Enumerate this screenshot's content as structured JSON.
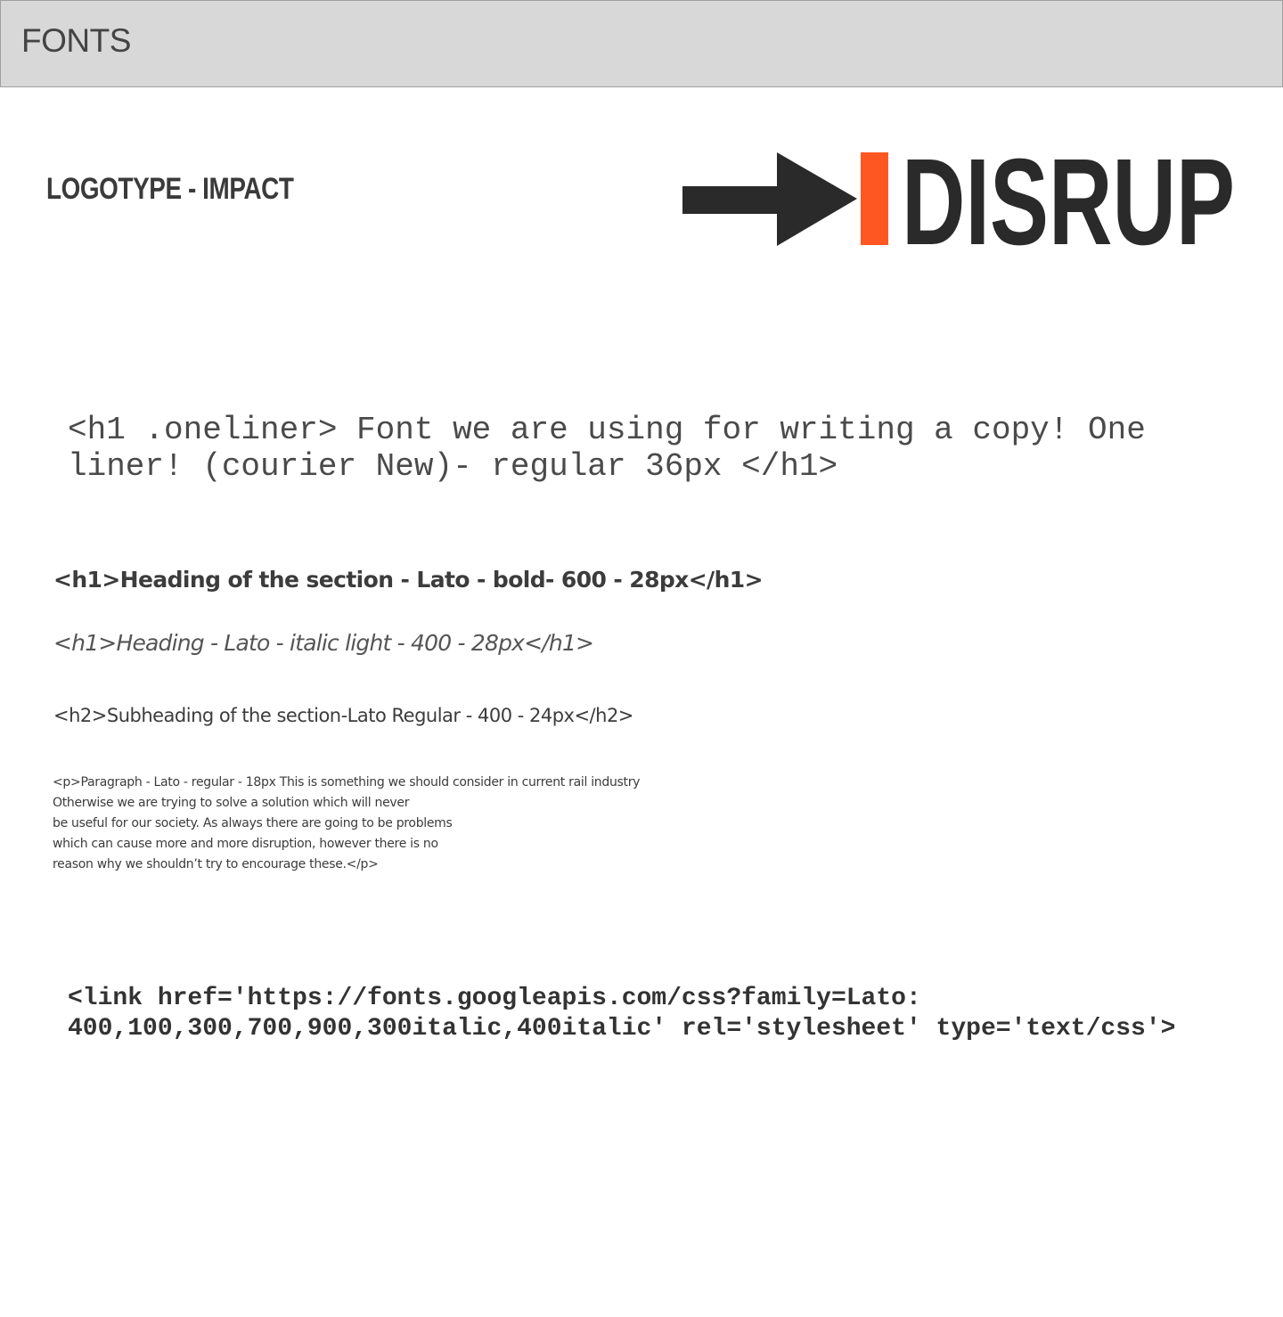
{
  "header": {
    "title": "FONTS"
  },
  "logotype": {
    "label": "LOGOTYPE - IMPACT",
    "logo_text": "DISRUP",
    "colors": {
      "arrow": "#2a2a2a",
      "bar": "#ff5722",
      "text": "#2a2a2a"
    }
  },
  "samples": {
    "oneliner": "<h1 .oneliner> Font we are using for writing a copy! One liner! (courier New)- regular 36px </h1>",
    "heading_bold": "<h1>Heading of the section - Lato - bold- 600 - 28px</h1>",
    "heading_italic": "<h1>Heading - Lato - italic light - 400 - 28px</h1>",
    "subheading": "<h2>Subheading of the section-Lato Regular - 400 - 24px</h2>",
    "paragraph_lines": [
      "<p>Paragraph - Lato - regular - 18px  This is something we should consider in current rail industry",
      "Otherwise we are trying to solve a solution which will never",
      "be useful for our society.  As always there are going to be problems",
      "which can cause more and more disruption, however there is no",
      "reason why we shouldn’t try to encourage these.</p>"
    ]
  },
  "link_snippet": {
    "lines": [
      "<link href='https://fonts.googleapis.com/css?family=Lato:",
      "400,100,300,700,900,300italic,400italic' rel='stylesheet' type='text/css'>"
    ]
  }
}
